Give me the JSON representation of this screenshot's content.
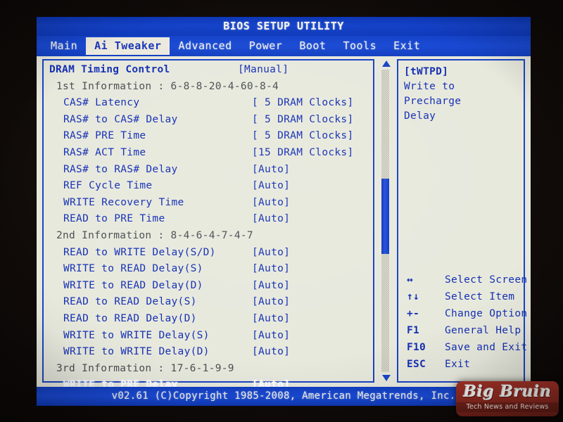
{
  "window": {
    "title": "BIOS SETUP UTILITY",
    "firmware_footer": "v02.61 (C)Copyright 1985-2008, American Megatrends, Inc."
  },
  "menu": {
    "tabs": [
      {
        "label": "Main",
        "active": false
      },
      {
        "label": "Ai Tweaker",
        "active": true
      },
      {
        "label": "Advanced",
        "active": false
      },
      {
        "label": "Power",
        "active": false
      },
      {
        "label": "Boot",
        "active": false
      },
      {
        "label": "Tools",
        "active": false
      },
      {
        "label": "Exit",
        "active": false
      }
    ]
  },
  "settings": {
    "rows": [
      {
        "label": "DRAM Timing Control",
        "value": "[Manual]",
        "kind": "setting",
        "indent": 0,
        "selected": false
      },
      {
        "label": "1st Information : 6-8-8-20-4-60-8-4",
        "value": "",
        "kind": "info",
        "indent": 1,
        "selected": false
      },
      {
        "label": "CAS# Latency",
        "value": "[ 5 DRAM Clocks]",
        "kind": "setting",
        "indent": 2,
        "selected": false
      },
      {
        "label": "RAS# to CAS# Delay",
        "value": "[ 5 DRAM Clocks]",
        "kind": "setting",
        "indent": 2,
        "selected": false
      },
      {
        "label": "RAS# PRE Time",
        "value": "[ 5 DRAM Clocks]",
        "kind": "setting",
        "indent": 2,
        "selected": false
      },
      {
        "label": "RAS# ACT Time",
        "value": "[15 DRAM Clocks]",
        "kind": "setting",
        "indent": 2,
        "selected": false
      },
      {
        "label": "RAS# to RAS# Delay",
        "value": "[Auto]",
        "kind": "setting",
        "indent": 2,
        "selected": false
      },
      {
        "label": "REF Cycle Time",
        "value": "[Auto]",
        "kind": "setting",
        "indent": 2,
        "selected": false
      },
      {
        "label": "WRITE Recovery Time",
        "value": "[Auto]",
        "kind": "setting",
        "indent": 2,
        "selected": false
      },
      {
        "label": "READ to PRE Time",
        "value": "[Auto]",
        "kind": "setting",
        "indent": 2,
        "selected": false
      },
      {
        "label": "2nd Information : 8-4-6-4-7-4-7",
        "value": "",
        "kind": "info",
        "indent": 1,
        "selected": false
      },
      {
        "label": "READ to WRITE Delay(S/D)",
        "value": "[Auto]",
        "kind": "setting",
        "indent": 2,
        "selected": false
      },
      {
        "label": "WRITE to READ Delay(S)",
        "value": "[Auto]",
        "kind": "setting",
        "indent": 2,
        "selected": false
      },
      {
        "label": "WRITE to READ Delay(D)",
        "value": "[Auto]",
        "kind": "setting",
        "indent": 2,
        "selected": false
      },
      {
        "label": "READ to READ Delay(S)",
        "value": "[Auto]",
        "kind": "setting",
        "indent": 2,
        "selected": false
      },
      {
        "label": "READ to READ Delay(D)",
        "value": "[Auto]",
        "kind": "setting",
        "indent": 2,
        "selected": false
      },
      {
        "label": "WRITE to WRITE Delay(S)",
        "value": "[Auto]",
        "kind": "setting",
        "indent": 2,
        "selected": false
      },
      {
        "label": "WRITE to WRITE Delay(D)",
        "value": "[Auto]",
        "kind": "setting",
        "indent": 2,
        "selected": false
      },
      {
        "label": "3rd Information : 17-6-1-9-9",
        "value": "",
        "kind": "info",
        "indent": 1,
        "selected": false
      },
      {
        "label": "WRITE to PRE Delay",
        "value": "[Auto]",
        "kind": "setting",
        "indent": 2,
        "selected": true
      }
    ]
  },
  "scrollbar": {
    "up_arrow": "scroll-up-arrow-icon",
    "down_arrow": "scroll-down-arrow-icon"
  },
  "help": {
    "code": "[tWTPD]",
    "line1": "Write to Precharge",
    "line2": "Delay"
  },
  "legend": {
    "items": [
      {
        "key": "↔",
        "action": "Select Screen"
      },
      {
        "key": "↑↓",
        "action": "Select Item"
      },
      {
        "key": "+-",
        "action": "Change Option"
      },
      {
        "key": "F1",
        "action": "General Help"
      },
      {
        "key": "F10",
        "action": "Save and Exit"
      },
      {
        "key": "ESC",
        "action": "Exit"
      }
    ]
  },
  "watermark": {
    "brand": "Big Bruin",
    "slogan": "Tech News and Reviews"
  },
  "colors": {
    "chrome_blue": "#1a4ad4",
    "screen_bg": "#e8e9dd",
    "text_blue": "#1430b4",
    "info_gray": "#4a4f52",
    "selected_white": "#ffffff",
    "logo_red": "#a03126"
  }
}
